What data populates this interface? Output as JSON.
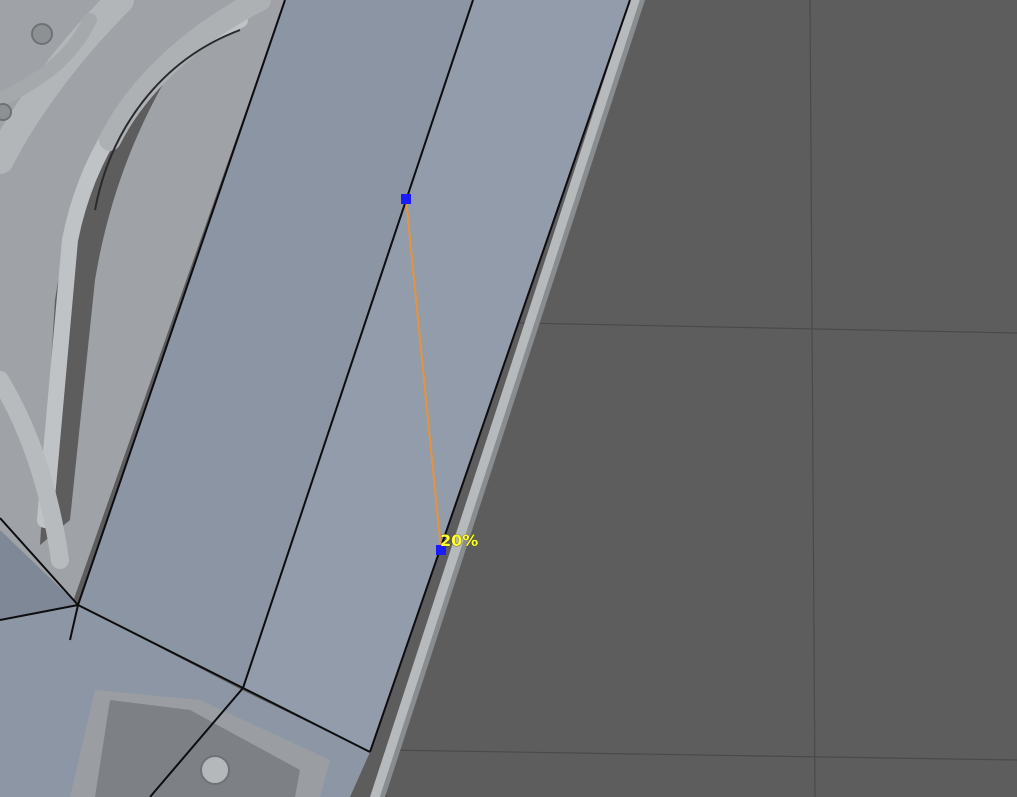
{
  "viewport": {
    "background_color": "#5d5d5e",
    "grid_line_color": "#4a4a4b",
    "mesh_face_color": "#8c95a4",
    "mesh_face_light_color": "#939cab",
    "mesh_edge_color": "#0d0d10",
    "frame_color": "#a9acaf",
    "frame_shadow_color": "#6f7275"
  },
  "knife_tool": {
    "cut_line_color": "#e8923a",
    "vertex_color": "#1a1aff",
    "percent_label": "20%",
    "percent_label_color": "#ffff33"
  }
}
